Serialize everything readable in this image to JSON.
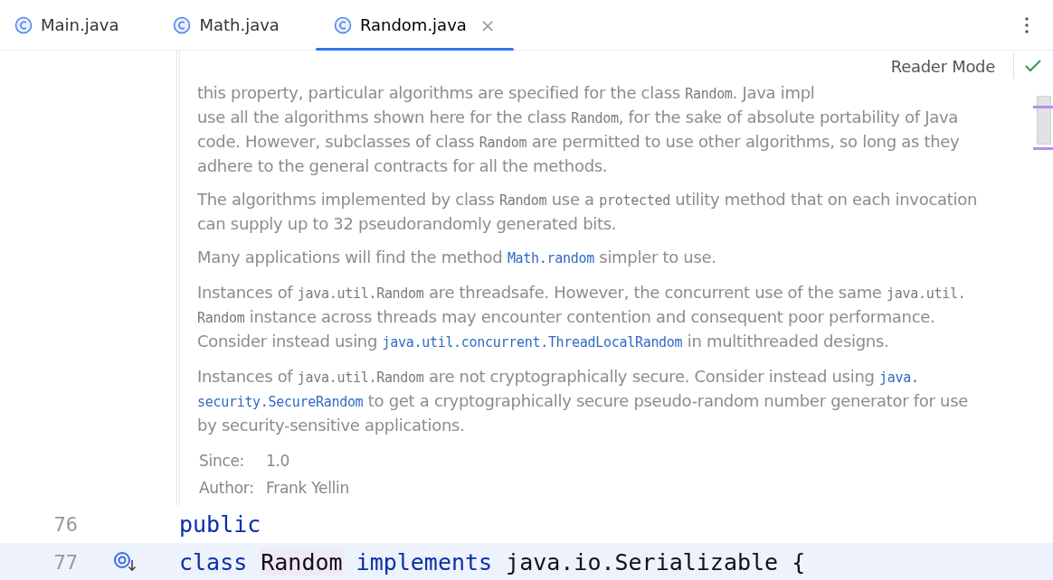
{
  "tabs": [
    {
      "label": "Main.java",
      "selected": false
    },
    {
      "label": "Math.java",
      "selected": false
    },
    {
      "label": "Random.java",
      "selected": true
    }
  ],
  "close_glyph": "×",
  "reader_mode": {
    "label": "Reader Mode"
  },
  "doc": {
    "paragraphs": [
      {
        "lines": [
          [
            {
              "kind": "text",
              "text": "this property, particular algorithms are specified for the class "
            },
            {
              "kind": "code",
              "text": "Random"
            },
            {
              "kind": "text",
              "text": ". Java impl"
            }
          ],
          [
            {
              "kind": "text",
              "text": "use all the algorithms shown here for the class "
            },
            {
              "kind": "code",
              "text": "Random"
            },
            {
              "kind": "text",
              "text": ", for the sake of absolute portability of Java"
            }
          ],
          [
            {
              "kind": "text",
              "text": "code. However, subclasses of class "
            },
            {
              "kind": "code",
              "text": "Random"
            },
            {
              "kind": "text",
              "text": " are permitted to use other algorithms, so long as they"
            }
          ],
          [
            {
              "kind": "text",
              "text": "adhere to the general contracts for all the methods."
            }
          ]
        ]
      },
      {
        "lines": [
          [
            {
              "kind": "text",
              "text": "The algorithms implemented by class "
            },
            {
              "kind": "code",
              "text": "Random"
            },
            {
              "kind": "text",
              "text": " use a "
            },
            {
              "kind": "code",
              "text": "protected"
            },
            {
              "kind": "text",
              "text": " utility method that on each invocation"
            }
          ],
          [
            {
              "kind": "text",
              "text": "can supply up to 32 pseudorandomly generated bits."
            }
          ]
        ]
      },
      {
        "lines": [
          [
            {
              "kind": "text",
              "text": "Many applications will find the method "
            },
            {
              "kind": "link",
              "text": "Math.random"
            },
            {
              "kind": "text",
              "text": " simpler to use."
            }
          ]
        ]
      },
      {
        "lines": [
          [
            {
              "kind": "text",
              "text": "Instances of "
            },
            {
              "kind": "code",
              "text": "java.util.Random"
            },
            {
              "kind": "text",
              "text": " are threadsafe. However, the concurrent use of the same "
            },
            {
              "kind": "code",
              "text": "java.util."
            }
          ],
          [
            {
              "kind": "code",
              "text": "Random"
            },
            {
              "kind": "text",
              "text": " instance across threads may encounter contention and consequent poor performance."
            }
          ],
          [
            {
              "kind": "text",
              "text": "Consider instead using "
            },
            {
              "kind": "link",
              "text": "java.util.concurrent.ThreadLocalRandom"
            },
            {
              "kind": "text",
              "text": " in multithreaded designs."
            }
          ]
        ]
      },
      {
        "lines": [
          [
            {
              "kind": "text",
              "text": "Instances of "
            },
            {
              "kind": "code",
              "text": "java.util.Random"
            },
            {
              "kind": "text",
              "text": " are not cryptographically secure. Consider instead using "
            },
            {
              "kind": "link",
              "text": "java."
            }
          ],
          [
            {
              "kind": "link",
              "text": "security.SecureRandom"
            },
            {
              "kind": "text",
              "text": " to get a cryptographically secure pseudo-random number generator for use"
            }
          ],
          [
            {
              "kind": "text",
              "text": "by security-sensitive applications."
            }
          ]
        ]
      }
    ],
    "tags": [
      {
        "label": "Since:",
        "value": "1.0"
      },
      {
        "label": "Author:",
        "value": "Frank Yellin"
      }
    ]
  },
  "code_lines": [
    {
      "number": "76",
      "current": false,
      "gutter_icon": false,
      "tokens": [
        {
          "kind": "keyword",
          "text": "public"
        }
      ]
    },
    {
      "number": "77",
      "current": true,
      "gutter_icon": true,
      "tokens": [
        {
          "kind": "keyword",
          "text": "class"
        },
        {
          "kind": "highlight",
          "text": "Random"
        },
        {
          "kind": "keyword",
          "text": "implements"
        },
        {
          "kind": "plain",
          "text": "java.io.Serializable {"
        }
      ]
    }
  ]
}
